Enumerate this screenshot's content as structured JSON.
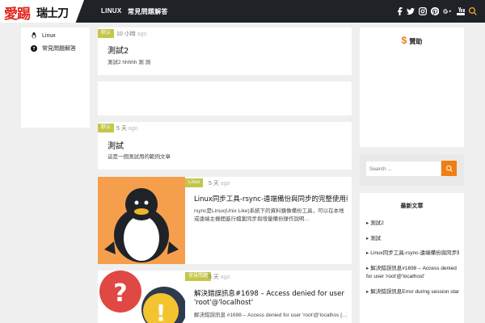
{
  "header": {
    "logo_red": "愛踢",
    "logo_black": "瑞士刀",
    "nav": [
      "LINUX",
      "常見問題解答"
    ],
    "social_icons": [
      "facebook-icon",
      "twitter-icon",
      "instagram-icon",
      "pinterest-icon",
      "google-plus-icon",
      "youtube-icon",
      "search-icon"
    ]
  },
  "sidebar": {
    "items": [
      {
        "label": "Linux",
        "icon": "linux-icon"
      },
      {
        "label": "常見問題解答",
        "icon": "question-icon"
      }
    ]
  },
  "posts": [
    {
      "badge": "默认",
      "time": "10 小時",
      "ago": "ago",
      "title": "測試2",
      "excerpt": "測試2 hhhhh 測 測"
    },
    {
      "badge": "默认",
      "time": "5 天",
      "ago": "ago",
      "title": "測試",
      "excerpt": "這是一個測試用的範例文章"
    },
    {
      "badge": "Linux",
      "time": "5 天",
      "ago": "ago",
      "title": "Linux同步工具-rsync-遠端備份與同步的完整使用教學說明",
      "excerpt": "rsync是Linux(Unix Like)系統下的資料鏡像備份工具，可以在本地或遠端主機間進行檔案同步與增量備份操作說明…"
    },
    {
      "badge": "常見問題",
      "time": "5 天",
      "ago": "ago",
      "title_line1": "解決錯誤訊息#1698 – Access denied for user",
      "title_line2": "'root'@'localhost'",
      "excerpt": "解決錯誤訊息 #1698 – Access denied for user 'root'@'localhos […]"
    }
  ],
  "right": {
    "donate_label": "贊助",
    "search_placeholder": "Search ...",
    "recent_title": "最新文章",
    "recent": [
      "測試2",
      "測試",
      "Linux同步工具-rsync-遠端備份與同步的完整使用教學",
      "解決錯誤訊息#1698 – Access denied for user 'root'@'localhost'",
      "解決錯誤訊息Error during session start"
    ]
  },
  "colors": {
    "topbar": "#1f2328",
    "badge": "#c4c64a",
    "accent_orange": "#f07e13",
    "thumb_orange": "#f59f4d",
    "logo_red": "#e1261c"
  }
}
